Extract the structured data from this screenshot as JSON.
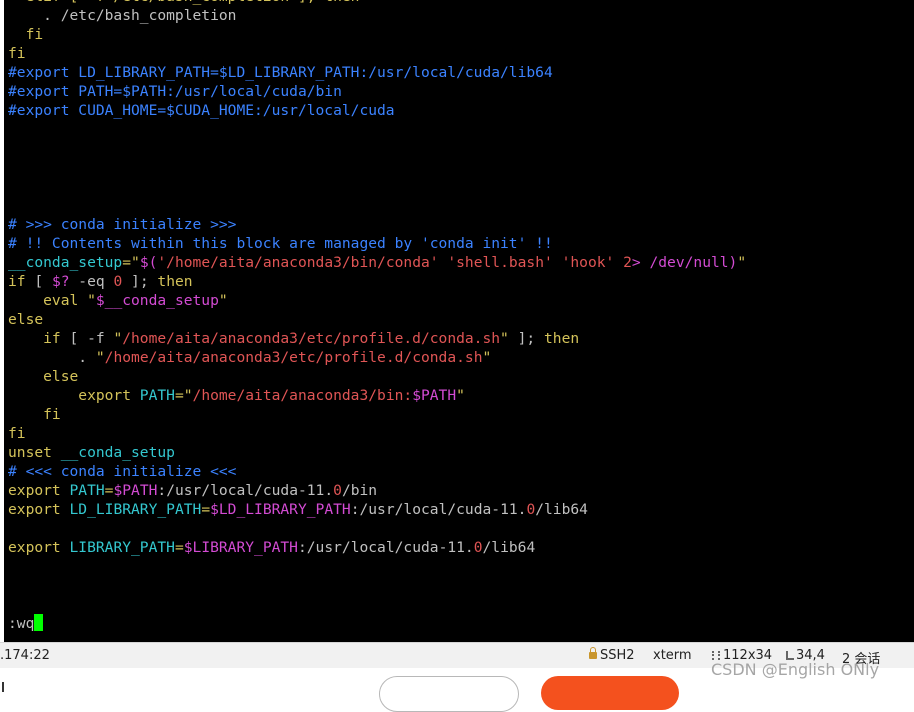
{
  "colors": {
    "terminal_bg": "#000000",
    "default_text": "#c0c0c0",
    "comment": "#3b82ff",
    "keyword": "#d4c35a",
    "string": "#e05555",
    "variable": "#d34bd3",
    "cyan": "#34c8d0",
    "cursor": "#00ff00"
  },
  "terminal": {
    "lines": [
      [
        {
          "t": "  elif [ -f /etc/bash_completion ]; then",
          "c": "keyword"
        }
      ],
      [
        {
          "t": "    . /etc/bash_completion",
          "c": "default"
        }
      ],
      [
        {
          "t": "  fi",
          "c": "keyword"
        }
      ],
      [
        {
          "t": "fi",
          "c": "keyword"
        }
      ],
      [
        {
          "t": "#export LD_LIBRARY_PATH=$LD_LIBRARY_PATH:/usr/local/cuda/lib64",
          "c": "comment"
        }
      ],
      [
        {
          "t": "#export PATH=$PATH:/usr/local/cuda/bin",
          "c": "comment"
        }
      ],
      [
        {
          "t": "#export CUDA_HOME=$CUDA_HOME:/usr/local/cuda",
          "c": "comment"
        }
      ],
      [],
      [],
      [],
      [],
      [],
      [
        {
          "t": "# >>> conda initialize >>>",
          "c": "comment"
        }
      ],
      [
        {
          "t": "# !! Contents within this block are managed by 'conda init' !!",
          "c": "comment"
        }
      ],
      [
        {
          "t": "__conda_setup",
          "c": "cyan"
        },
        {
          "t": "=\"",
          "c": "keyword"
        },
        {
          "t": "$(",
          "c": "variable"
        },
        {
          "t": "'/home/aita/anaconda3/bin/conda'",
          "c": "string"
        },
        {
          "t": " ",
          "c": "default"
        },
        {
          "t": "'shell.bash'",
          "c": "string"
        },
        {
          "t": " ",
          "c": "default"
        },
        {
          "t": "'hook'",
          "c": "string"
        },
        {
          "t": " ",
          "c": "default"
        },
        {
          "t": "2",
          "c": "string"
        },
        {
          "t": "> /dev/null)",
          "c": "variable"
        },
        {
          "t": "\"",
          "c": "keyword"
        }
      ],
      [
        {
          "t": "if",
          "c": "keyword"
        },
        {
          "t": " [ ",
          "c": "default"
        },
        {
          "t": "$?",
          "c": "variable"
        },
        {
          "t": " -eq ",
          "c": "default"
        },
        {
          "t": "0",
          "c": "string"
        },
        {
          "t": " ]; ",
          "c": "default"
        },
        {
          "t": "then",
          "c": "keyword"
        }
      ],
      [
        {
          "t": "    eval ",
          "c": "keyword"
        },
        {
          "t": "\"",
          "c": "keyword"
        },
        {
          "t": "$__conda_setup",
          "c": "variable"
        },
        {
          "t": "\"",
          "c": "keyword"
        }
      ],
      [
        {
          "t": "else",
          "c": "keyword"
        }
      ],
      [
        {
          "t": "    if",
          "c": "keyword"
        },
        {
          "t": " [ -f ",
          "c": "default"
        },
        {
          "t": "\"",
          "c": "keyword"
        },
        {
          "t": "/home/aita/anaconda3/etc/profile.d/conda.sh",
          "c": "string"
        },
        {
          "t": "\"",
          "c": "keyword"
        },
        {
          "t": " ]; ",
          "c": "default"
        },
        {
          "t": "then",
          "c": "keyword"
        }
      ],
      [
        {
          "t": "        . ",
          "c": "default"
        },
        {
          "t": "\"",
          "c": "keyword"
        },
        {
          "t": "/home/aita/anaconda3/etc/profile.d/conda.sh",
          "c": "string"
        },
        {
          "t": "\"",
          "c": "keyword"
        }
      ],
      [
        {
          "t": "    else",
          "c": "keyword"
        }
      ],
      [
        {
          "t": "        export ",
          "c": "keyword"
        },
        {
          "t": "PATH",
          "c": "cyan"
        },
        {
          "t": "=\"",
          "c": "keyword"
        },
        {
          "t": "/home/aita/anaconda3/bin:",
          "c": "string"
        },
        {
          "t": "$PATH",
          "c": "variable"
        },
        {
          "t": "\"",
          "c": "keyword"
        }
      ],
      [
        {
          "t": "    fi",
          "c": "keyword"
        }
      ],
      [
        {
          "t": "fi",
          "c": "keyword"
        }
      ],
      [
        {
          "t": "unset ",
          "c": "keyword"
        },
        {
          "t": "__conda_setup",
          "c": "cyan"
        }
      ],
      [
        {
          "t": "# <<< conda initialize <<<",
          "c": "comment"
        }
      ],
      [
        {
          "t": "export ",
          "c": "keyword"
        },
        {
          "t": "PATH",
          "c": "cyan"
        },
        {
          "t": "=",
          "c": "keyword"
        },
        {
          "t": "$PATH",
          "c": "variable"
        },
        {
          "t": ":/usr/local/cuda-11.",
          "c": "default"
        },
        {
          "t": "0",
          "c": "string"
        },
        {
          "t": "/bin",
          "c": "default"
        }
      ],
      [
        {
          "t": "export ",
          "c": "keyword"
        },
        {
          "t": "LD_LIBRARY_PATH",
          "c": "cyan"
        },
        {
          "t": "=",
          "c": "keyword"
        },
        {
          "t": "$LD_LIBRARY_PATH",
          "c": "variable"
        },
        {
          "t": ":/usr/local/cuda-11.",
          "c": "default"
        },
        {
          "t": "0",
          "c": "string"
        },
        {
          "t": "/lib64",
          "c": "default"
        }
      ],
      [],
      [
        {
          "t": "export ",
          "c": "keyword"
        },
        {
          "t": "LIBRARY_PATH",
          "c": "cyan"
        },
        {
          "t": "=",
          "c": "keyword"
        },
        {
          "t": "$LIBRARY_PATH",
          "c": "variable"
        },
        {
          "t": ":/usr/local/cuda-11.",
          "c": "default"
        },
        {
          "t": "0",
          "c": "string"
        },
        {
          "t": "/lib64",
          "c": "default"
        }
      ],
      [],
      [],
      [],
      [
        {
          "t": ":wq",
          "c": "default"
        },
        {
          "cursor": true
        }
      ]
    ]
  },
  "statusbar": {
    "host": ".174:22",
    "protocol": "SSH2",
    "terminal_type": "xterm",
    "size": "112x34",
    "position": "34,4",
    "sessions": "2 会话"
  },
  "watermark": "CSDN @English ONly"
}
